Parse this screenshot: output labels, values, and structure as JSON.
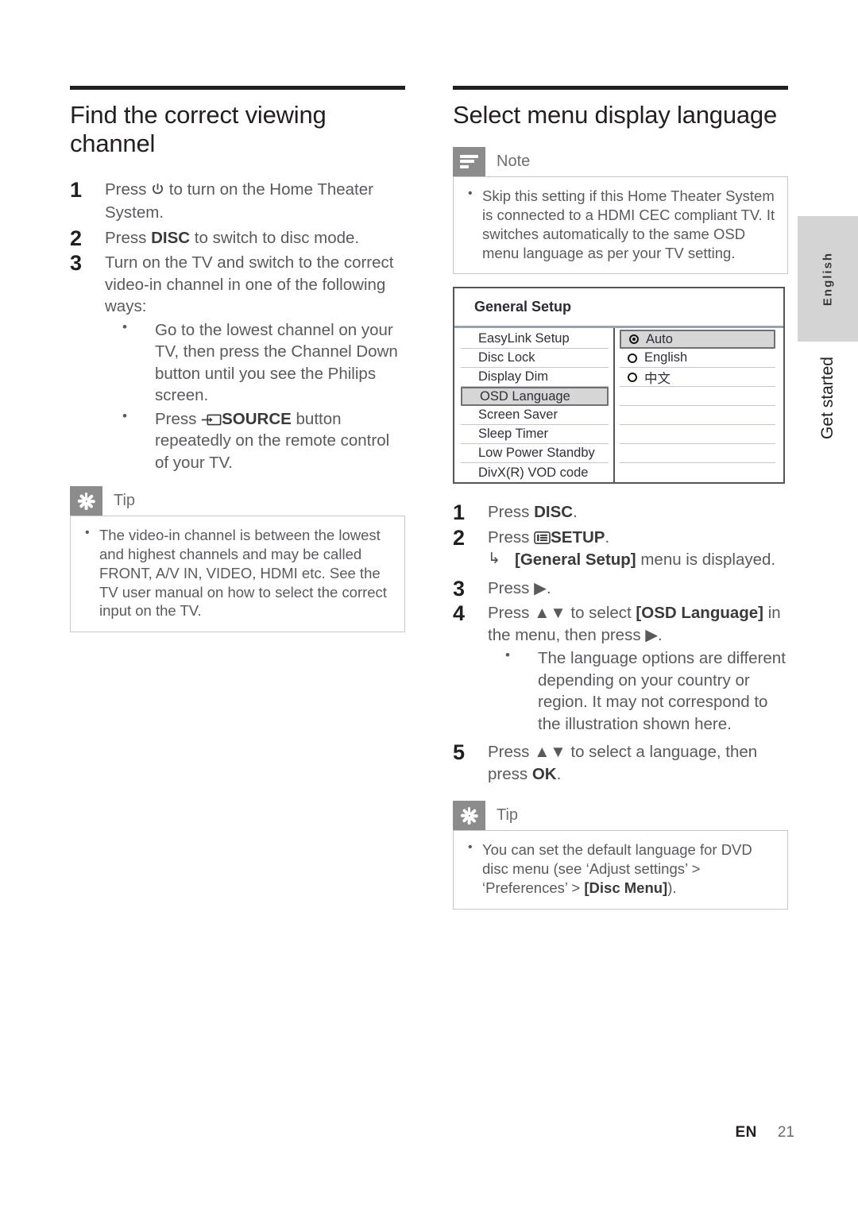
{
  "left": {
    "title": "Find the correct viewing channel",
    "steps": [
      {
        "num": "1",
        "pre": "Press ",
        "icon": "power-icon",
        "post": " to turn on the Home Theater System."
      },
      {
        "num": "2",
        "pre": "Press ",
        "bold": "DISC",
        "post": " to switch to disc mode."
      },
      {
        "num": "3",
        "text": "Turn on the TV and switch to the correct video-in channel in one of the following ways:",
        "bullets": [
          "Go to the lowest channel on your TV, then press the Channel Down button until you see the Philips screen.",
          "Press  SOURCE button repeatedly on the remote control of your TV."
        ],
        "bullet2_pre": "Press ",
        "bullet2_bold": "SOURCE",
        "bullet2_post": " button repeatedly on the remote control of your TV."
      }
    ],
    "tip": {
      "label": "Tip",
      "icon": "sparkle-icon",
      "text": "The video-in channel is between the lowest and highest channels and may be called FRONT, A/V IN, VIDEO, HDMI etc. See the TV user manual on how to select the correct input on the TV."
    }
  },
  "right": {
    "title": "Select menu display language",
    "note": {
      "label": "Note",
      "icon": "note-lines-icon",
      "text": "Skip this setting if this Home Theater System is connected to a HDMI CEC compliant TV. It switches automatically to the same OSD menu language as per your TV setting."
    },
    "osd": {
      "title": "General Setup",
      "menu_items": [
        {
          "label": "EasyLink Setup",
          "selected": false
        },
        {
          "label": "Disc Lock",
          "selected": false
        },
        {
          "label": "Display Dim",
          "selected": false
        },
        {
          "label": "OSD Language",
          "selected": true
        },
        {
          "label": "Screen Saver",
          "selected": false
        },
        {
          "label": "Sleep Timer",
          "selected": false
        },
        {
          "label": "Low Power Standby",
          "selected": false
        },
        {
          "label": "DivX(R) VOD code",
          "selected": false
        }
      ],
      "options": [
        {
          "label": "Auto",
          "checked": true,
          "selected": true
        },
        {
          "label": "English",
          "checked": false,
          "selected": false
        },
        {
          "label": "中文",
          "checked": false,
          "selected": false
        }
      ],
      "highlight_fill": "#d6d6d6",
      "highlight_border": "#6f6f74",
      "separator_color": "#9aa2ae"
    },
    "steps": [
      {
        "num": "1",
        "pre": "Press ",
        "bold": "DISC",
        "post": "."
      },
      {
        "num": "2",
        "pre": "Press ",
        "icon": "setup-icon",
        "bold": "SETUP",
        "post": ".",
        "result_arrow": "↳",
        "result_bold": "[General Setup]",
        "result_post": " menu is displayed."
      },
      {
        "num": "3",
        "pre": "Press ",
        "post": "▶."
      },
      {
        "num": "4",
        "pre": "Press ▲▼ to select ",
        "bold": "[OSD Language]",
        "post": " in the menu, then press ▶.",
        "bullets": [
          "The language options are different depending on your country or region. It may not correspond to the illustration shown here."
        ]
      },
      {
        "num": "5",
        "pre": "Press ▲▼ to select a language, then press ",
        "bold": "OK",
        "post": "."
      }
    ],
    "tip": {
      "label": "Tip",
      "icon": "sparkle-icon",
      "pre": "You can set the default language for DVD disc menu (see ‘Adjust settings’ > ‘Preferences’ > ",
      "bold": "[Disc Menu]",
      "post": ")."
    }
  },
  "side_tabs": {
    "language": "English",
    "chapter": "Get started"
  },
  "footer": {
    "lang_code": "EN",
    "page_number": "21"
  }
}
